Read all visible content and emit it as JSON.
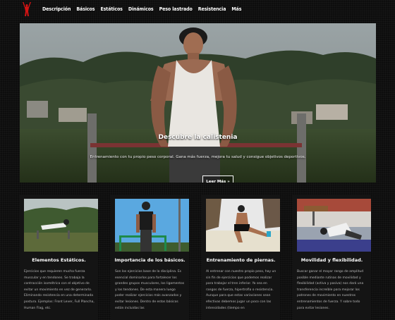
{
  "nav": {
    "logo_icon": "athlete-silhouette-logo",
    "logo_color": "#d11414",
    "items": [
      "Descripción",
      "Básicos",
      "Estáticos",
      "Dinámicos",
      "Peso lastrado",
      "Resistencia",
      "Más"
    ]
  },
  "hero": {
    "title": "Descubre la calistenia",
    "subtitle": "Entrenamiento con tu propio peso corporal. Gana más fuerza, mejora tu salud y consigue objetivos deportivos.",
    "button": "Leer Más »"
  },
  "cards": [
    {
      "title": "Elementos Estáticos.",
      "text": "Ejercicios que requieren mucha fuerza muscular y en tendones. Se trabaja la contracción isométrica con el objetivo de evitar un movimiento en vez de generarlo. Eliminando resistencia en una determinada postura. Ejemplos: Front Lever, Full Plancha, Human Flag, etc."
    },
    {
      "title": "Importancia de los básicos.",
      "text": "Son los ejercicios base de la disciplina. Es esencial dominarlos para fortalecer los grandes grupos musculares, los ligamentos y los tendones. De esta manera luego poder realizar ejercicios más avanzados y evitar lesiones. Dentro de estos básicos están incluidas las"
    },
    {
      "title": "Entrenamiento de piernas.",
      "text": "Al entrenar con nuestro propio peso, hay un sin fin de ejercicios que podemos realizar para trabajar el tren inferior. Ya sea en rangos de fuerza, hipertrofia o resistencia. Aunque para que estas variaciones sean efectivas debemos jugar un poco con las intensidades (tiempo en"
    },
    {
      "title": "Movilidad y flexibilidad.",
      "text": "Buscar ganar el mayor rango de amplitud posible mediante rutinas de movilidad y flexibilidad (activa y pasiva) nos dará una transferencia increíble para mejorar los patrones de movimiento en nuestros entrenamientos de fuerza. Y sobre todo para evitar lesiones."
    }
  ]
}
